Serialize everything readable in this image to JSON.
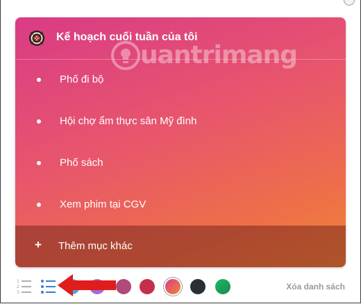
{
  "card": {
    "title": "Kế hoạch cuối tuần của tôi",
    "header_icon": "dartboard-icon",
    "watermark": "uantrimang",
    "items": [
      {
        "label": "Phố đi bộ"
      },
      {
        "label": "Hội chợ ẩm thực sân Mỹ đình"
      },
      {
        "label": "Phố sách"
      },
      {
        "label": "Xem phim tại CGV"
      }
    ],
    "add_label": "Thêm mục khác",
    "add_icon": "plus-icon"
  },
  "toolbar": {
    "numbered_list_icon": "numbered-list-icon",
    "bulleted_list_icon": "bulleted-list-icon",
    "swatches": [
      {
        "color": "#4aa8e0"
      },
      {
        "color": "#a56ad6"
      },
      {
        "color": "#b04a7a"
      },
      {
        "color": "#c4304a"
      },
      {
        "color": "#ec6a4a",
        "selected": true
      },
      {
        "color": "#2a2f36"
      },
      {
        "color": "#1fa05a"
      }
    ],
    "clear_label": "Xóa danh sách"
  },
  "colors": {
    "accent": "#3a7bd5",
    "arrow": "#e01d1d"
  }
}
